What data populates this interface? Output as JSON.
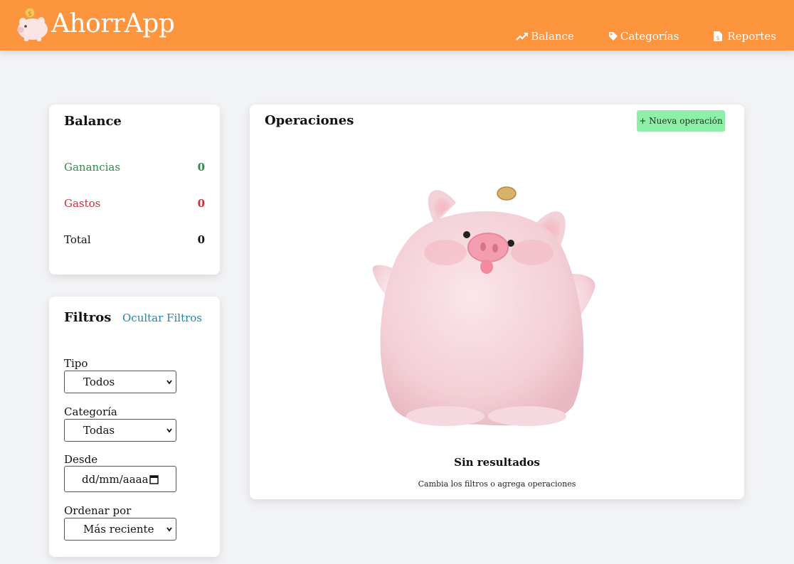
{
  "app": {
    "name": "AhorrApp"
  },
  "nav": {
    "items": [
      {
        "label": "Balance",
        "icon": "trend-up-icon"
      },
      {
        "label": "Categorías",
        "icon": "tag-icon"
      },
      {
        "label": "Reportes",
        "icon": "report-icon"
      }
    ]
  },
  "balance": {
    "title": "Balance",
    "rows": [
      {
        "label": "Ganancias",
        "value": "0",
        "color": "#2e8b46"
      },
      {
        "label": "Gastos",
        "value": "0",
        "color": "#c8323c"
      },
      {
        "label": "Total",
        "value": "0",
        "color": "#111111"
      }
    ]
  },
  "filters": {
    "title": "Filtros",
    "toggle_label": "Ocultar Filtros",
    "fields": [
      {
        "label": "Tipo",
        "value": "Todos"
      },
      {
        "label": "Categoría",
        "value": "Todas"
      },
      {
        "label": "Desde",
        "value": "dd/mm/aaaa"
      },
      {
        "label": "Ordenar por",
        "value": "Más reciente"
      }
    ]
  },
  "operations": {
    "title": "Operaciones",
    "new_button": "+ Nueva operación",
    "empty_title": "Sin resultados",
    "empty_subtitle": "Cambia los filtros o agrega operaciones"
  },
  "colors": {
    "header": "#fd943e",
    "accent_button": "#8ef0a8",
    "link": "#2386a8"
  }
}
